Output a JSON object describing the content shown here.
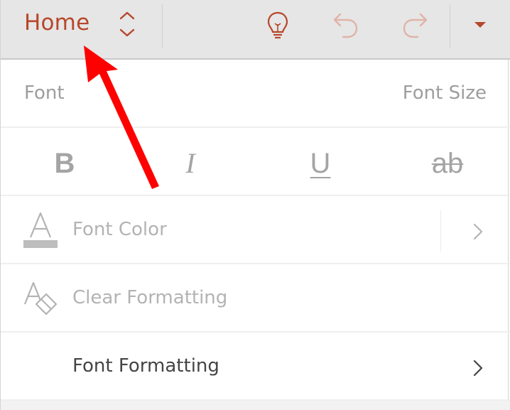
{
  "toolbar": {
    "tab_title": "Home",
    "icons": {
      "switcher": "chevron-up-down-icon",
      "tell_me": "lightbulb-icon",
      "undo": "undo-icon",
      "redo": "redo-icon",
      "more": "caret-down-icon"
    }
  },
  "font_section": {
    "font_label": "Font",
    "font_size_label": "Font Size"
  },
  "style_buttons": {
    "bold": "B",
    "italic": "I",
    "underline": "U",
    "strikethrough": "ab"
  },
  "menu": {
    "font_color": "Font Color",
    "clear_formatting": "Clear Formatting",
    "font_formatting": "Font Formatting"
  },
  "colors": {
    "accent": "#b7472a",
    "disabled_text": "#b3b3b3",
    "annotation_arrow": "#ff0000"
  }
}
